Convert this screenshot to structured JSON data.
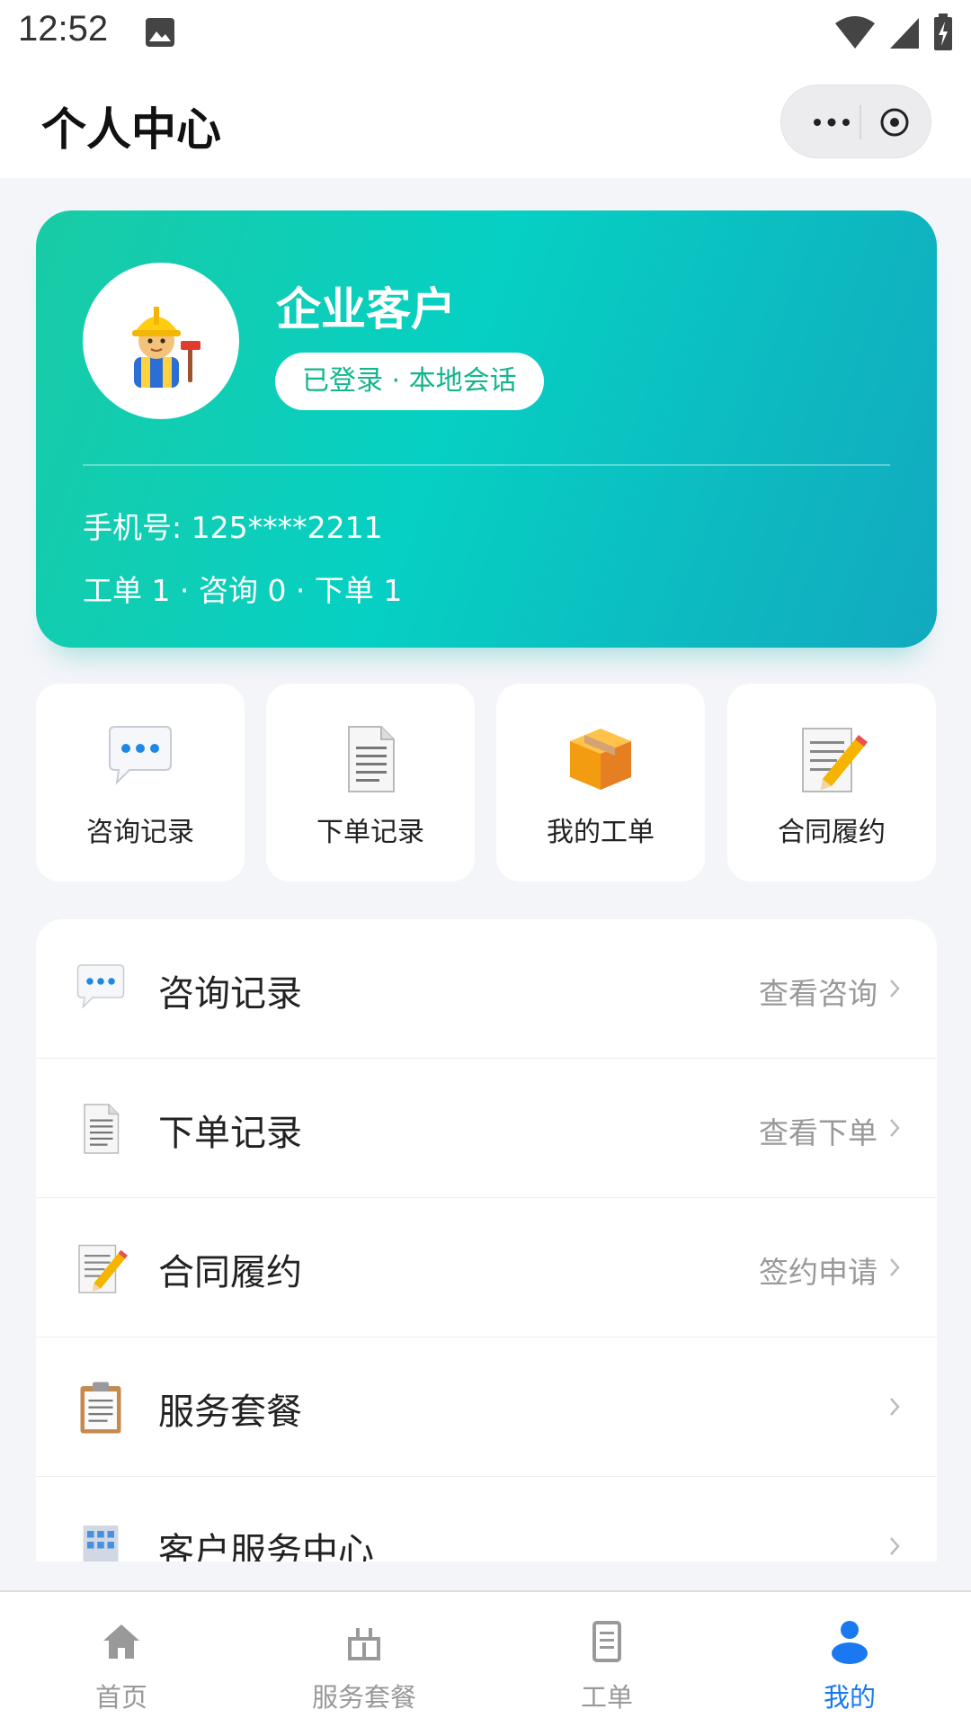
{
  "status_bar": {
    "time": "12:52"
  },
  "header": {
    "title": "个人中心"
  },
  "profile": {
    "name": "企业客户",
    "badge": "已登录 · 本地会话",
    "phone": "手机号: 125****2211",
    "stats": "工单 1 · 咨询 0 · 下单 1"
  },
  "quick_actions": [
    {
      "label": "咨询记录",
      "icon": "speech-bubble-icon"
    },
    {
      "label": "下单记录",
      "icon": "document-icon"
    },
    {
      "label": "我的工单",
      "icon": "package-icon"
    },
    {
      "label": "合同履约",
      "icon": "memo-pencil-icon"
    }
  ],
  "menu": [
    {
      "label": "咨询记录",
      "hint": "查看咨询",
      "icon": "speech-bubble-icon"
    },
    {
      "label": "下单记录",
      "hint": "查看下单",
      "icon": "document-icon"
    },
    {
      "label": "合同履约",
      "hint": "签约申请",
      "icon": "memo-pencil-icon"
    },
    {
      "label": "服务套餐",
      "hint": "",
      "icon": "clipboard-icon"
    },
    {
      "label": "客户服务中心",
      "hint": "",
      "icon": "office-building-icon"
    }
  ],
  "tabs": [
    {
      "label": "首页",
      "icon": "home-icon",
      "active": false
    },
    {
      "label": "服务套餐",
      "icon": "package-tab-icon",
      "active": false
    },
    {
      "label": "工单",
      "icon": "ticket-icon",
      "active": false
    },
    {
      "label": "我的",
      "icon": "person-icon",
      "active": true
    }
  ],
  "colors": {
    "card_gradient_start": "#19cba5",
    "card_gradient_end": "#12a9bf",
    "badge_text": "#14b58e",
    "tab_active": "#1a78f0",
    "tab_inactive": "#999999"
  }
}
